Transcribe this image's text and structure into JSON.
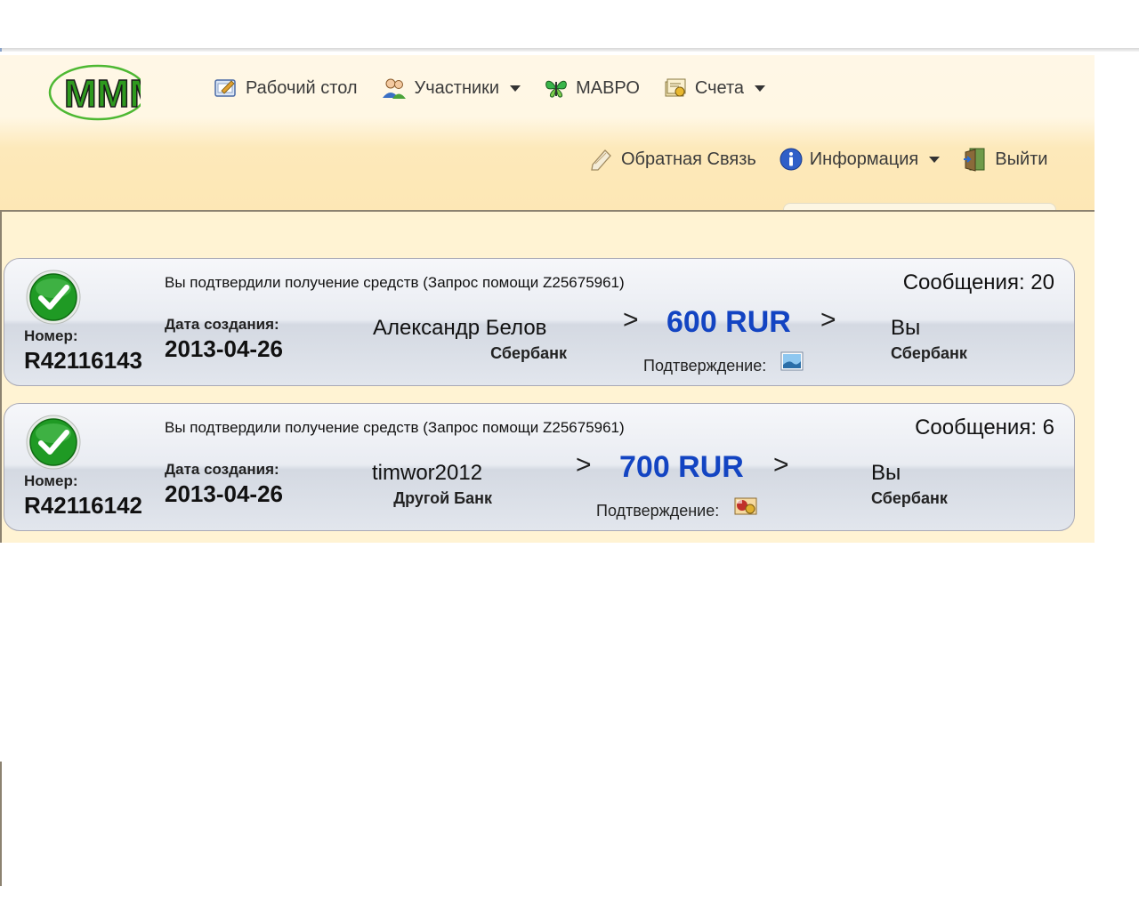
{
  "header": {
    "logo_text": "MMM",
    "nav_top": [
      {
        "label": "Рабочий стол",
        "icon": "desktop-icon"
      },
      {
        "label": "Участники",
        "icon": "users-icon"
      },
      {
        "label": "МАВРО",
        "icon": "butterfly-icon"
      },
      {
        "label": "Счета",
        "icon": "accounts-icon"
      }
    ],
    "nav_bottom": [
      {
        "label": "Обратная Связь",
        "icon": "feedback-icon"
      },
      {
        "label": "Информация",
        "icon": "info-icon"
      },
      {
        "label": "Выйти",
        "icon": "exit-door-icon"
      }
    ]
  },
  "requests": [
    {
      "status": "Вы подтвердили получение средств (Запрос помощи Z25675961)",
      "messages": "Сообщения: 20",
      "number_label": "Номер:",
      "number": "R42116143",
      "date_label": "Дата создания:",
      "date": "2013-04-26",
      "sender_name": "Александр Белов",
      "sender_bank": "Сбербанк",
      "arrow": ">",
      "amount": "600 RUR",
      "confirm_label": "Подтверждение:",
      "confirm_icon": "image-icon",
      "recipient_name": "Вы",
      "recipient_bank": "Сбербанк"
    },
    {
      "status": "Вы подтвердили получение средств (Запрос помощи Z25675961)",
      "messages": "Сообщения: 6",
      "number_label": "Номер:",
      "number": "R42116142",
      "date_label": "Дата создания:",
      "date": "2013-04-26",
      "sender_name": "timwor2012",
      "sender_bank": "Другой Банк",
      "arrow": ">",
      "amount": "700 RUR",
      "confirm_label": "Подтверждение:",
      "confirm_icon": "photo-attachment-icon",
      "recipient_name": "Вы",
      "recipient_bank": "Сбербанк"
    }
  ],
  "colors": {
    "amount": "#1344c2",
    "header_bg": "#fde9ba",
    "content_bg": "#fff3d3",
    "check_green": "#1f9a24"
  }
}
